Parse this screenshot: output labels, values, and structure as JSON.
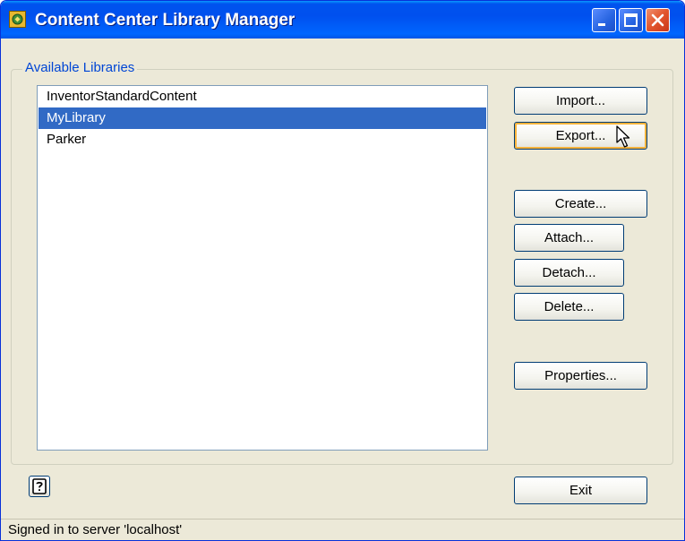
{
  "window": {
    "title": "Content Center Library Manager"
  },
  "libraries": {
    "group_label": "Available Libraries",
    "items": [
      "InventorStandardContent",
      "MyLibrary",
      "Parker"
    ],
    "selected": "MyLibrary"
  },
  "buttons": {
    "import": "Import...",
    "export": "Export...",
    "create": "Create...",
    "attach": "Attach...",
    "detach": "Detach...",
    "delete": "Delete...",
    "properties": "Properties...",
    "exit": "Exit"
  },
  "status": {
    "text": "Signed in to server 'localhost'"
  },
  "icons": {
    "app": "library-app-icon",
    "help": "help-icon",
    "minimize": "minimize-icon",
    "maximize": "maximize-icon",
    "close": "close-icon",
    "cursor": "mouse-pointer-icon"
  },
  "colors": {
    "titlebar": "#0055E5",
    "selection": "#316AC5",
    "accent_label": "#0046D5",
    "window_bg": "#ECE9D8"
  }
}
